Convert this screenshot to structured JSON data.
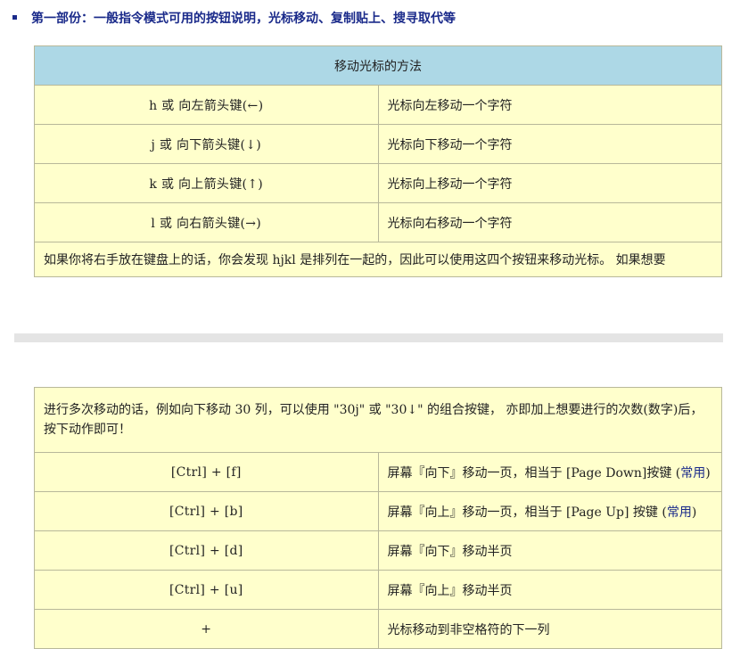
{
  "section_heading": "第一部份：一般指令模式可用的按钮说明，光标移动、复制贴上、搜寻取代等",
  "table1": {
    "header": "移动光标的方法",
    "rows": [
      {
        "key": "h 或 向左箭头键(←)",
        "desc": "光标向左移动一个字符"
      },
      {
        "key": "j 或 向下箭头键(↓)",
        "desc": "光标向下移动一个字符"
      },
      {
        "key": "k 或 向上箭头键(↑)",
        "desc": "光标向上移动一个字符"
      },
      {
        "key": "l 或 向右箭头键(→)",
        "desc": "光标向右移动一个字符"
      }
    ],
    "note": "如果你将右手放在键盘上的话，你会发现 hjkl 是排列在一起的，因此可以使用这四个按钮来移动光标。 如果想要"
  },
  "table2": {
    "intro": "进行多次移动的话，例如向下移动 30 列，可以使用 \"30j\" 或 \"30↓\" 的组合按键， 亦即加上想要进行的次数(数字)后，按下动作即可！",
    "rows": [
      {
        "key": "[Ctrl] + [f]",
        "desc": "屏幕『向下』移动一页，相当于 [Page Down]按键 (",
        "accent": "常用",
        "tail": ")"
      },
      {
        "key": "[Ctrl] + [b]",
        "desc": "屏幕『向上』移动一页，相当于 [Page Up] 按键 (",
        "accent": "常用",
        "tail": ")"
      },
      {
        "key": "[Ctrl] + [d]",
        "desc": "屏幕『向下』移动半页",
        "accent": "",
        "tail": ""
      },
      {
        "key": "[Ctrl] + [u]",
        "desc": "屏幕『向上』移动半页",
        "accent": "",
        "tail": ""
      },
      {
        "key": "+",
        "desc": "光标移动到非空格符的下一列",
        "accent": "",
        "tail": ""
      }
    ]
  },
  "colors": {
    "heading": "#1a2a8a",
    "table_header_bg": "#add8e6",
    "table_cell_bg": "#ffffcc",
    "divider": "#e4e4e4"
  }
}
